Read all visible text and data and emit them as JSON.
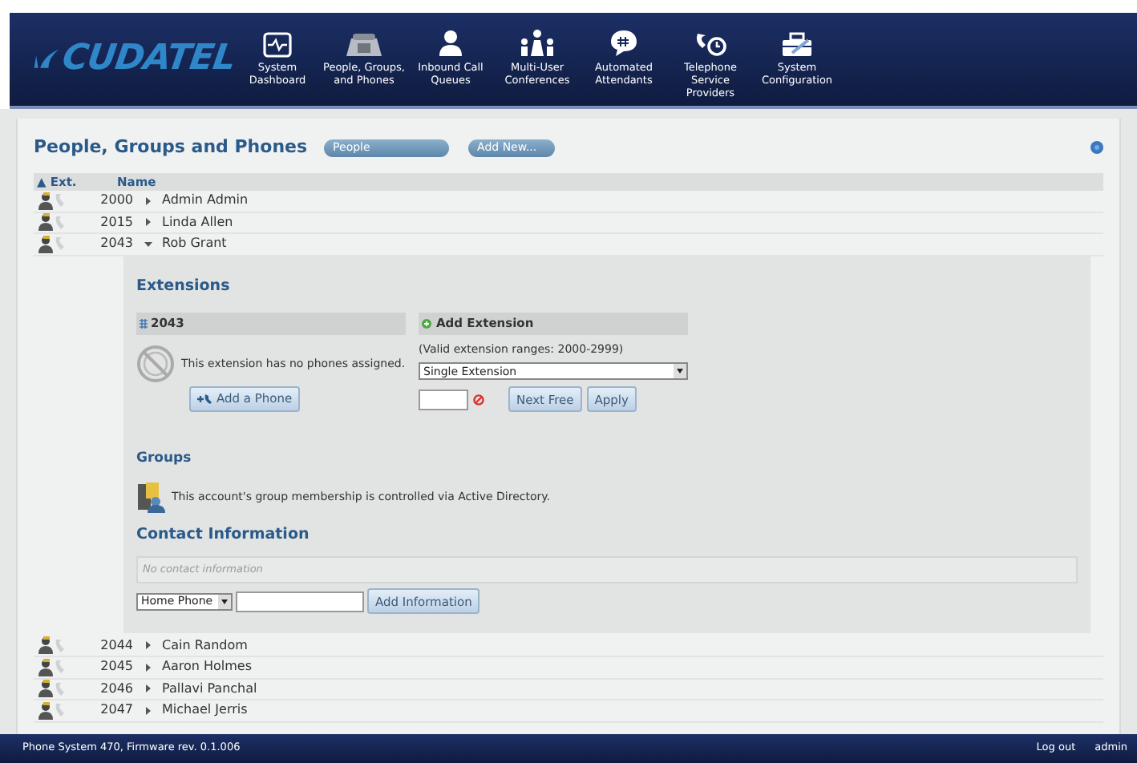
{
  "brand": {
    "logo": "CUDATEL"
  },
  "nav": [
    {
      "lines": [
        "System",
        "Dashboard"
      ]
    },
    {
      "lines": [
        "People, Groups,",
        "and Phones"
      ]
    },
    {
      "lines": [
        "Inbound Call",
        "Queues"
      ]
    },
    {
      "lines": [
        "Multi-User",
        "Conferences"
      ]
    },
    {
      "lines": [
        "Automated",
        "Attendants"
      ]
    },
    {
      "lines": [
        "Telephone",
        "Service",
        "Providers"
      ]
    },
    {
      "lines": [
        "System",
        "Configuration"
      ]
    }
  ],
  "page": {
    "title": "People, Groups and Phones",
    "filter": "People",
    "add_button": "Add New..."
  },
  "table": {
    "columns": [
      "▲ Ext.",
      "Name"
    ],
    "rows_before": [
      {
        "ext": "2000",
        "name": "Admin Admin",
        "expanded": false
      },
      {
        "ext": "2015",
        "name": "Linda Allen",
        "expanded": false
      },
      {
        "ext": "2043",
        "name": "Rob Grant",
        "expanded": true
      }
    ],
    "rows_after": [
      {
        "ext": "2044",
        "name": "Cain Random",
        "expanded": false
      },
      {
        "ext": "2045",
        "name": "Aaron Holmes",
        "expanded": false
      },
      {
        "ext": "2046",
        "name": "Pallavi Panchal",
        "expanded": false
      },
      {
        "ext": "2047",
        "name": "Michael Jerris",
        "expanded": false
      }
    ]
  },
  "detail": {
    "extensions_heading": "Extensions",
    "ext_panel": {
      "title": "2043",
      "message": "This extension has no phones assigned.",
      "button": "Add a Phone"
    },
    "add_panel": {
      "title": "Add Extension",
      "note": "(Valid extension ranges: 2000-2999)",
      "select": "Single Extension",
      "buttons": [
        "Next Free",
        "Apply"
      ]
    },
    "groups_heading": "Groups",
    "groups_message": "This account's group membership is controlled via Active Directory.",
    "contact_heading": "Contact Information",
    "contact_empty": "No contact information",
    "contact_type": "Home Phone",
    "contact_button": "Add Information"
  },
  "footer": {
    "version": "Phone System 470, Firmware rev. 0.1.006",
    "logout": "Log out",
    "user": "admin"
  }
}
